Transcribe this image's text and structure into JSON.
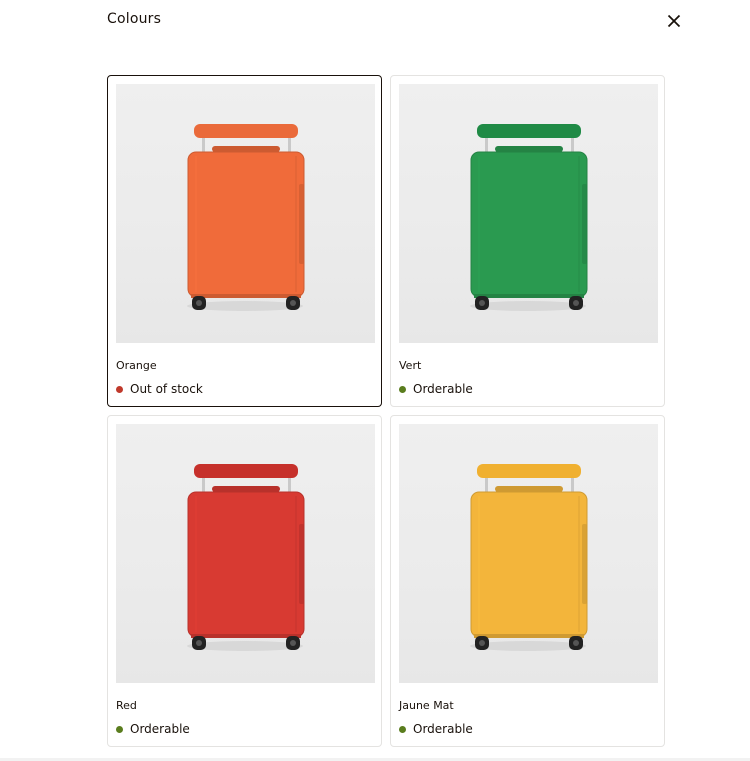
{
  "title": "Colours",
  "close_icon": "close-icon",
  "colors": {
    "out_of_stock": "#c0392b",
    "orderable": "#5a7d1e"
  },
  "items": [
    {
      "name": "Orange",
      "status": "Out of stock",
      "status_key": "out_of_stock",
      "selected": true,
      "color": "#f06b3a",
      "handle": "#ea6a3a"
    },
    {
      "name": "Vert",
      "status": "Orderable",
      "status_key": "orderable",
      "selected": false,
      "color": "#2a9a50",
      "handle": "#1f8a45"
    },
    {
      "name": "Red",
      "status": "Orderable",
      "status_key": "orderable",
      "selected": false,
      "color": "#d83a32",
      "handle": "#c6302b"
    },
    {
      "name": "Jaune Mat",
      "status": "Orderable",
      "status_key": "orderable",
      "selected": false,
      "color": "#f3b53b",
      "handle": "#f0b030"
    }
  ]
}
